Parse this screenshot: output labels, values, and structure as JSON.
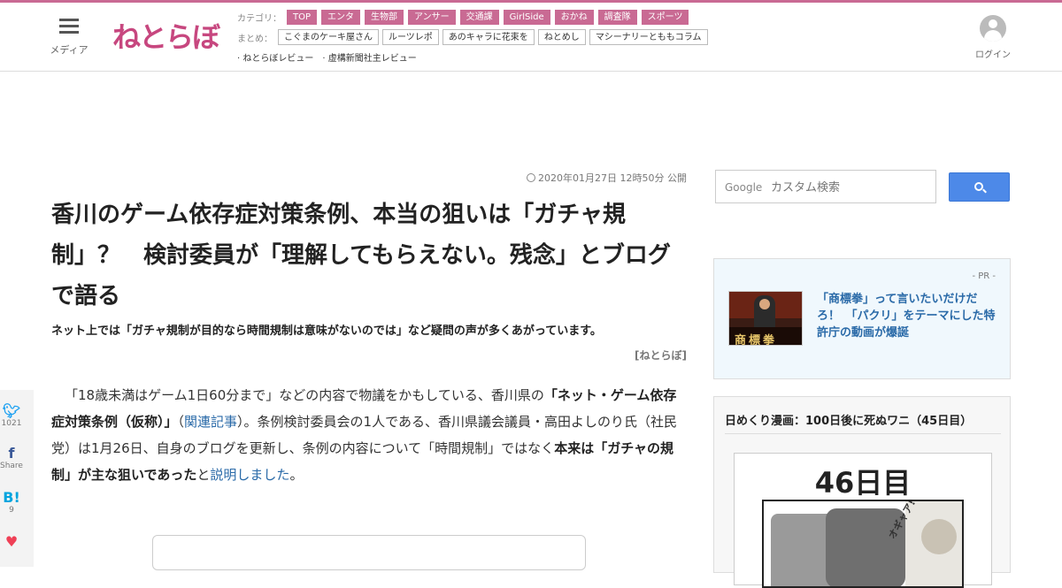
{
  "header": {
    "menu_label": "メディア",
    "logo_text": "ねとらぼ",
    "category_label": "カテゴリ：",
    "categories": [
      "TOP",
      "エンタ",
      "生物部",
      "アンサー",
      "交通課",
      "GirlSide",
      "おかね",
      "調査隊",
      "スポーツ"
    ],
    "summary_label": "まとめ：",
    "summaries": [
      "こぐまのケーキ屋さん",
      "ルーツレポ",
      "あのキャラに花束を",
      "ねとめし",
      "マシーナリーとももコラム"
    ],
    "reviews": [
      "· ねとらぼレビュー",
      "· 虚構新聞社主レビュー"
    ],
    "login_label": "ログイン"
  },
  "article": {
    "date": "2020年01月27日 12時50分 公開",
    "title": "香川のゲーム依存症対策条例、本当の狙いは「ガチャ規制」？　検討委員が「理解してもらえない。残念」とブログで語る",
    "subtitle": "ネット上では「ガチャ規制が目的なら時間規制は意味がないのでは」など疑問の声が多くあがっています。",
    "credit": "[ねとらぼ]",
    "body": {
      "p1": "「18歳未満はゲーム1日60分まで」などの内容で物議をかもしている、香川県の",
      "b1": "「ネット・ゲーム依存症対策条例（仮称）」",
      "p2": "（",
      "link1": "関連記事",
      "p3": "）。条例検討委員会の1人である、香川県議会議員・高田よしのり氏（社民党）は1月26日、自身のブログを更新し、条例の内容について「時間規制」ではなく",
      "b2": "本来は「ガチャの規制」が主な狙いであった",
      "p4": "と",
      "link2": "説明しました",
      "p5": "。"
    }
  },
  "share": {
    "twitter_count": "1021",
    "facebook_label": "Share",
    "hatena_count": "9"
  },
  "sidebar": {
    "search_brand": "Google",
    "search_placeholder": "カスタム検索",
    "pr_label": "- PR -",
    "pr_thumb_text": "商標拳",
    "pr_text": "「商標拳」って言いたいだけだろ！　「パクリ」をテーマにした特許庁の動画が爆誕",
    "manga_title": "日めくり漫画：100日後に死ぬワニ（45日目）",
    "manga_day": "46日目",
    "manga_sfx": "オギャア!!"
  },
  "colors": {
    "brand_pink": "#c96a93",
    "link_blue": "#2a6aa8",
    "search_blue": "#4d89e8"
  }
}
